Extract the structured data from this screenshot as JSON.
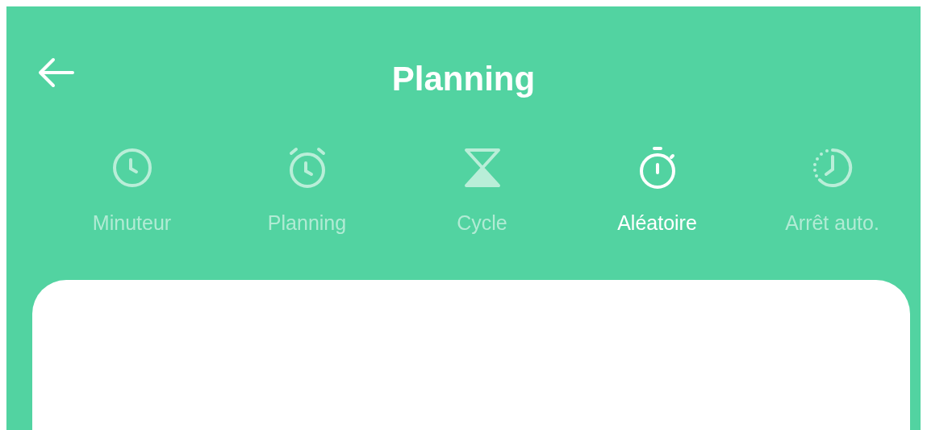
{
  "header": {
    "title": "Planning"
  },
  "tabs": [
    {
      "label": "Minuteur",
      "kind": "clock",
      "selected": false
    },
    {
      "label": "Planning",
      "kind": "alarm",
      "selected": false
    },
    {
      "label": "Cycle",
      "kind": "hourglass",
      "selected": false
    },
    {
      "label": "Aléatoire",
      "kind": "stopwatch",
      "selected": true
    },
    {
      "label": "Arrêt auto.",
      "kind": "countdown",
      "selected": false
    }
  ]
}
